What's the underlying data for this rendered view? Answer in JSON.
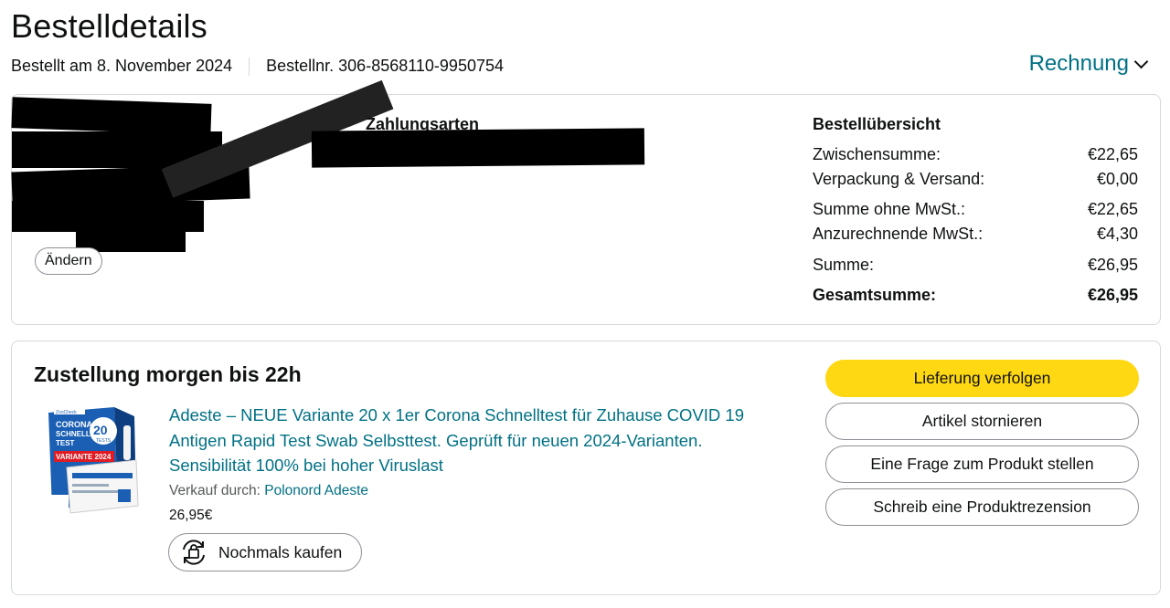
{
  "header": {
    "title": "Bestelldetails",
    "ordered_on": "Bestellt am 8. November 2024",
    "order_number": "Bestellnr. 306-8568110-9950754",
    "invoice_label": "Rechnung"
  },
  "summary_card": {
    "payment_heading": "Zahlungsarten",
    "edit_label": "Ändern",
    "order_summary": {
      "title": "Bestellübersicht",
      "rows": [
        {
          "label": "Zwischensumme:",
          "value": "€22,65"
        },
        {
          "label": "Verpackung & Versand:",
          "value": "€0,00"
        },
        {
          "label": "Summe ohne MwSt.:",
          "value": "€22,65"
        },
        {
          "label": "Anzurechnende MwSt.:",
          "value": "€4,30"
        },
        {
          "label": "Summe:",
          "value": "€26,95"
        }
      ],
      "total": {
        "label": "Gesamtsumme:",
        "value": "€26,95"
      }
    }
  },
  "delivery": {
    "title": "Zustellung morgen bis 22h",
    "product": {
      "title": "Adeste – NEUE Variante 20 x 1er Corona Schnelltest für Zuhause COVID 19 Antigen Rapid Test Swab Selbsttest. Geprüft für neuen 2024-Varianten. Sensibilität 100% bei hoher Viruslast",
      "seller_prefix": "Verkauf durch:",
      "seller_name": "Polonord Adeste",
      "price": "26,95€",
      "box_brand": "ZooCheck",
      "box_line1": "CORONA",
      "box_line2": "SCHNELL",
      "box_line3": "TEST",
      "box_count": "20",
      "box_count_label": "TESTS",
      "box_variant": "VARIANTE 2024"
    },
    "rebuy_label": "Nochmals kaufen",
    "actions": {
      "track": "Lieferung verfolgen",
      "cancel": "Artikel stornieren",
      "question": "Eine Frage zum Produkt stellen",
      "review": "Schreib eine Produktrezension"
    }
  },
  "colors": {
    "link": "#007185",
    "primary_button": "#ffd814",
    "text": "#0f1111",
    "border": "#d5d9d9"
  },
  "icons": {
    "invoice_dropdown": "chevron-down-icon",
    "rebuy": "rebuy-icon"
  }
}
